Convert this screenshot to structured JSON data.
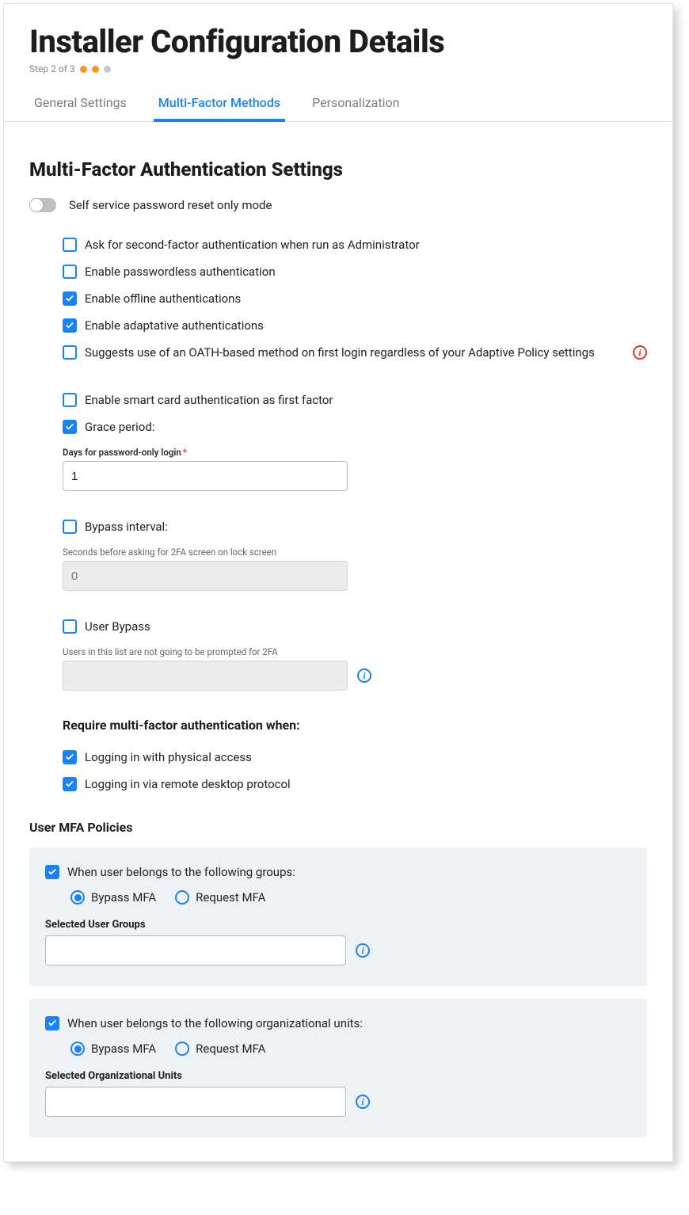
{
  "header": {
    "title": "Installer Configuration Details",
    "step_text": "Step 2 of 3"
  },
  "tabs": [
    {
      "label": "General Settings",
      "active": false
    },
    {
      "label": "Multi-Factor Methods",
      "active": true
    },
    {
      "label": "Personalization",
      "active": false
    }
  ],
  "mfa": {
    "section_title": "Multi-Factor Authentication Settings",
    "sspr_only_label": "Self service password reset only mode",
    "opts": {
      "admin_2fa": "Ask for second-factor authentication when run as Administrator",
      "passwordless": "Enable passwordless authentication",
      "offline": "Enable offline authentications",
      "adaptive": "Enable adaptative authentications",
      "oath_suggest": "Suggests use of an OATH-based method on first login regardless of your Adaptive Policy settings",
      "smartcard": "Enable smart card authentication as first factor",
      "grace_period": "Grace period:",
      "grace_field_label": "Days for password-only login",
      "grace_field_value": "1",
      "bypass_interval": "Bypass interval:",
      "bypass_help": "Seconds before asking for 2FA screen on lock screen",
      "bypass_value_placeholder": "0",
      "user_bypass": "User Bypass",
      "user_bypass_help": "Users in this list are not going to be prompted for 2FA"
    },
    "require_heading": "Require multi-factor authentication when:",
    "require": {
      "physical": "Logging in with physical access",
      "rdp": "Logging in via remote desktop protocol"
    }
  },
  "policies": {
    "heading": "User MFA Policies",
    "groups": {
      "label": "When user belongs to the following groups:",
      "bypass": "Bypass MFA",
      "request": "Request MFA",
      "field_label": "Selected User Groups"
    },
    "ous": {
      "label": "When user belongs to the following organizational units:",
      "bypass": "Bypass MFA",
      "request": "Request MFA",
      "field_label": "Selected Organizational Units"
    }
  }
}
